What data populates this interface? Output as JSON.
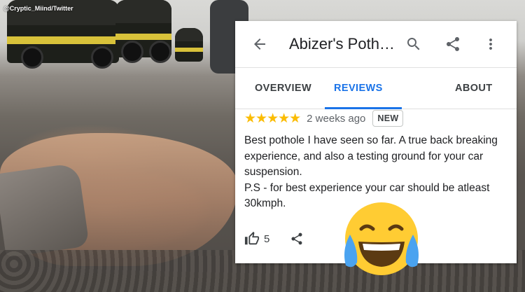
{
  "watermark": "@Cryptic_Miind/Twitter",
  "header": {
    "title": "Abizer's Poth…",
    "back_icon": "arrow-back-icon",
    "search_icon": "search-icon",
    "share_icon": "share-icon",
    "more_icon": "more-vert-icon"
  },
  "tabs": [
    {
      "label": "OVERVIEW",
      "active": false
    },
    {
      "label": "REVIEWS",
      "active": true
    },
    {
      "label": "ABOUT",
      "active": false
    }
  ],
  "review": {
    "stars": "★★★★★",
    "rating": 5,
    "time": "2 weeks ago",
    "badge": "NEW",
    "lines": [
      "Best pothole I have seen so far. A true back breaking experience, and also a testing ground for your car suspension.",
      "P.S - for best experience your car should be atleast 30kmph."
    ],
    "likes": "5"
  },
  "colors": {
    "accent": "#1a73e8",
    "star": "#fbbc04",
    "text": "#202124",
    "emoji_face": "#ffcc33"
  },
  "emoji": "face-with-tears-of-joy-emoji"
}
